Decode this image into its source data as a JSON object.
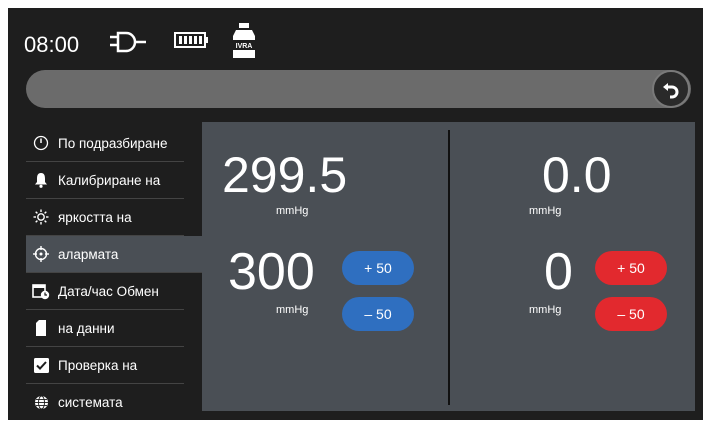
{
  "status": {
    "time": "08:00",
    "bottle_label": "IVRA"
  },
  "sidebar": {
    "items": [
      {
        "label": "По подразбиране",
        "icon": "gauge-icon"
      },
      {
        "label": "Калибриране на",
        "icon": "bell-icon"
      },
      {
        "label": "яркостта на",
        "icon": "brightness-icon"
      },
      {
        "label": "алармата",
        "icon": "crosshair-icon",
        "active": true
      },
      {
        "label": "Дата/час Обмен",
        "icon": "calendar-clock-icon"
      },
      {
        "label": "на данни",
        "icon": "sd-card-icon"
      },
      {
        "label": "Проверка на",
        "icon": "checkbox-icon"
      },
      {
        "label": "системата",
        "icon": "globe-icon"
      }
    ]
  },
  "left": {
    "measured": "299.5",
    "measured_unit": "mmHg",
    "setpoint": "300",
    "setpoint_unit": "mmHg",
    "plus_label": "+ 50",
    "minus_label": "– 50",
    "button_color": "#2f6fc0"
  },
  "right": {
    "measured": "0.0",
    "measured_unit": "mmHg",
    "setpoint": "0",
    "setpoint_unit": "mmHg",
    "plus_label": "+ 50",
    "minus_label": "– 50",
    "button_color": "#e2292e"
  }
}
